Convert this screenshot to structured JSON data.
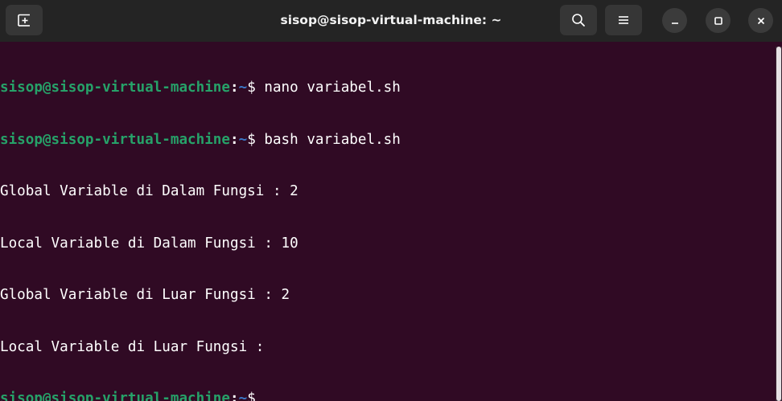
{
  "window": {
    "title": "sisop@sisop-virtual-machine: ~"
  },
  "colors": {
    "background": "#300a24",
    "titlebar": "#242424",
    "prompt_user": "#26a269",
    "prompt_path": "#3b78c7",
    "text": "#ffffff"
  },
  "icons": {
    "new_tab": "new-tab-icon",
    "search": "search-icon",
    "menu": "hamburger-menu-icon",
    "minimize": "minimize-icon",
    "maximize": "maximize-icon",
    "close": "close-icon"
  },
  "terminal": {
    "prompt": {
      "user_host": "sisop@sisop-virtual-machine",
      "separator": ":",
      "path": "~",
      "symbol": "$"
    },
    "commands": [
      " nano variabel.sh",
      " bash variabel.sh"
    ],
    "output": [
      "Global Variable di Dalam Fungsi : 2",
      "Local Variable di Dalam Fungsi : 10",
      "Global Variable di Luar Fungsi : 2",
      "Local Variable di Luar Fungsi : "
    ]
  }
}
